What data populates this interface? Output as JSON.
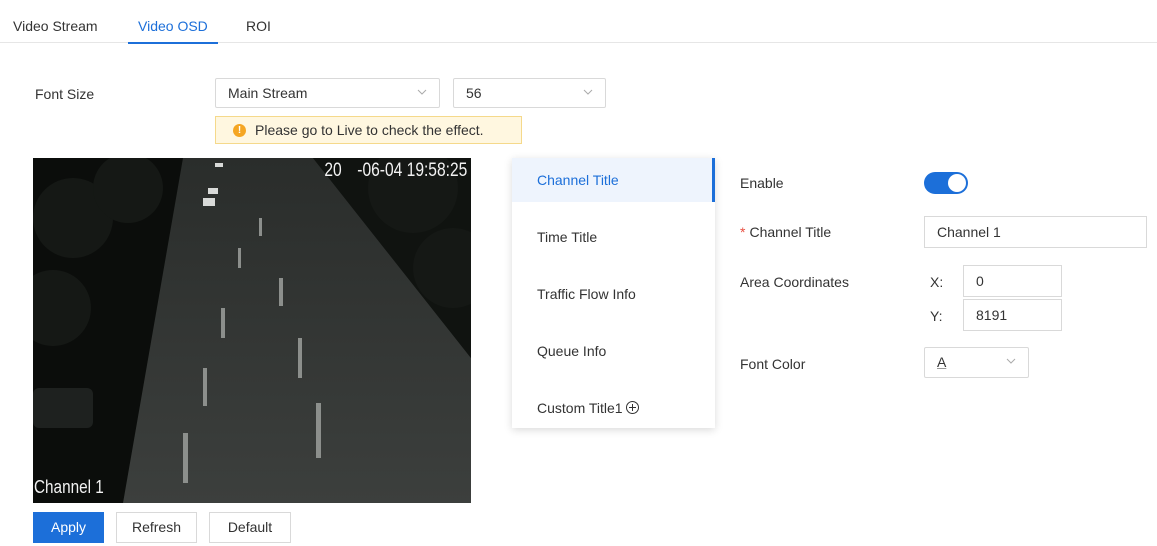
{
  "tabs": [
    {
      "label": "Video Stream",
      "active": false
    },
    {
      "label": "Video OSD",
      "active": true
    },
    {
      "label": "ROI",
      "active": false
    }
  ],
  "font_size": {
    "label": "Font Size",
    "stream_select": "Main Stream",
    "size_select": "56"
  },
  "notice": {
    "text": "Please go to Live to check the effect."
  },
  "video": {
    "timestamp": "20  -06-04 19:58:25",
    "channel_overlay": "Channel 1"
  },
  "osd_menu": {
    "items": [
      {
        "label": "Channel Title",
        "active": true
      },
      {
        "label": "Time Title",
        "active": false
      },
      {
        "label": "Traffic Flow Info",
        "active": false
      },
      {
        "label": "Queue Info",
        "active": false
      },
      {
        "label": "Custom Title1",
        "active": false,
        "icon": "add-circle-icon"
      }
    ]
  },
  "settings": {
    "enable_label": "Enable",
    "enable_value": true,
    "channel_title_required": "*",
    "channel_title_label": "Channel Title",
    "channel_title_value": "Channel 1",
    "area_label": "Area Coordinates",
    "x_label": "X:",
    "x_value": "0",
    "y_label": "Y:",
    "y_value": "8191",
    "font_color_label": "Font Color",
    "font_color_value": "A"
  },
  "buttons": {
    "apply": "Apply",
    "refresh": "Refresh",
    "default": "Default"
  },
  "colors": {
    "accent": "#1c6fd9",
    "notice_bg": "#fff7e0",
    "warning_icon": "#f5a623"
  }
}
